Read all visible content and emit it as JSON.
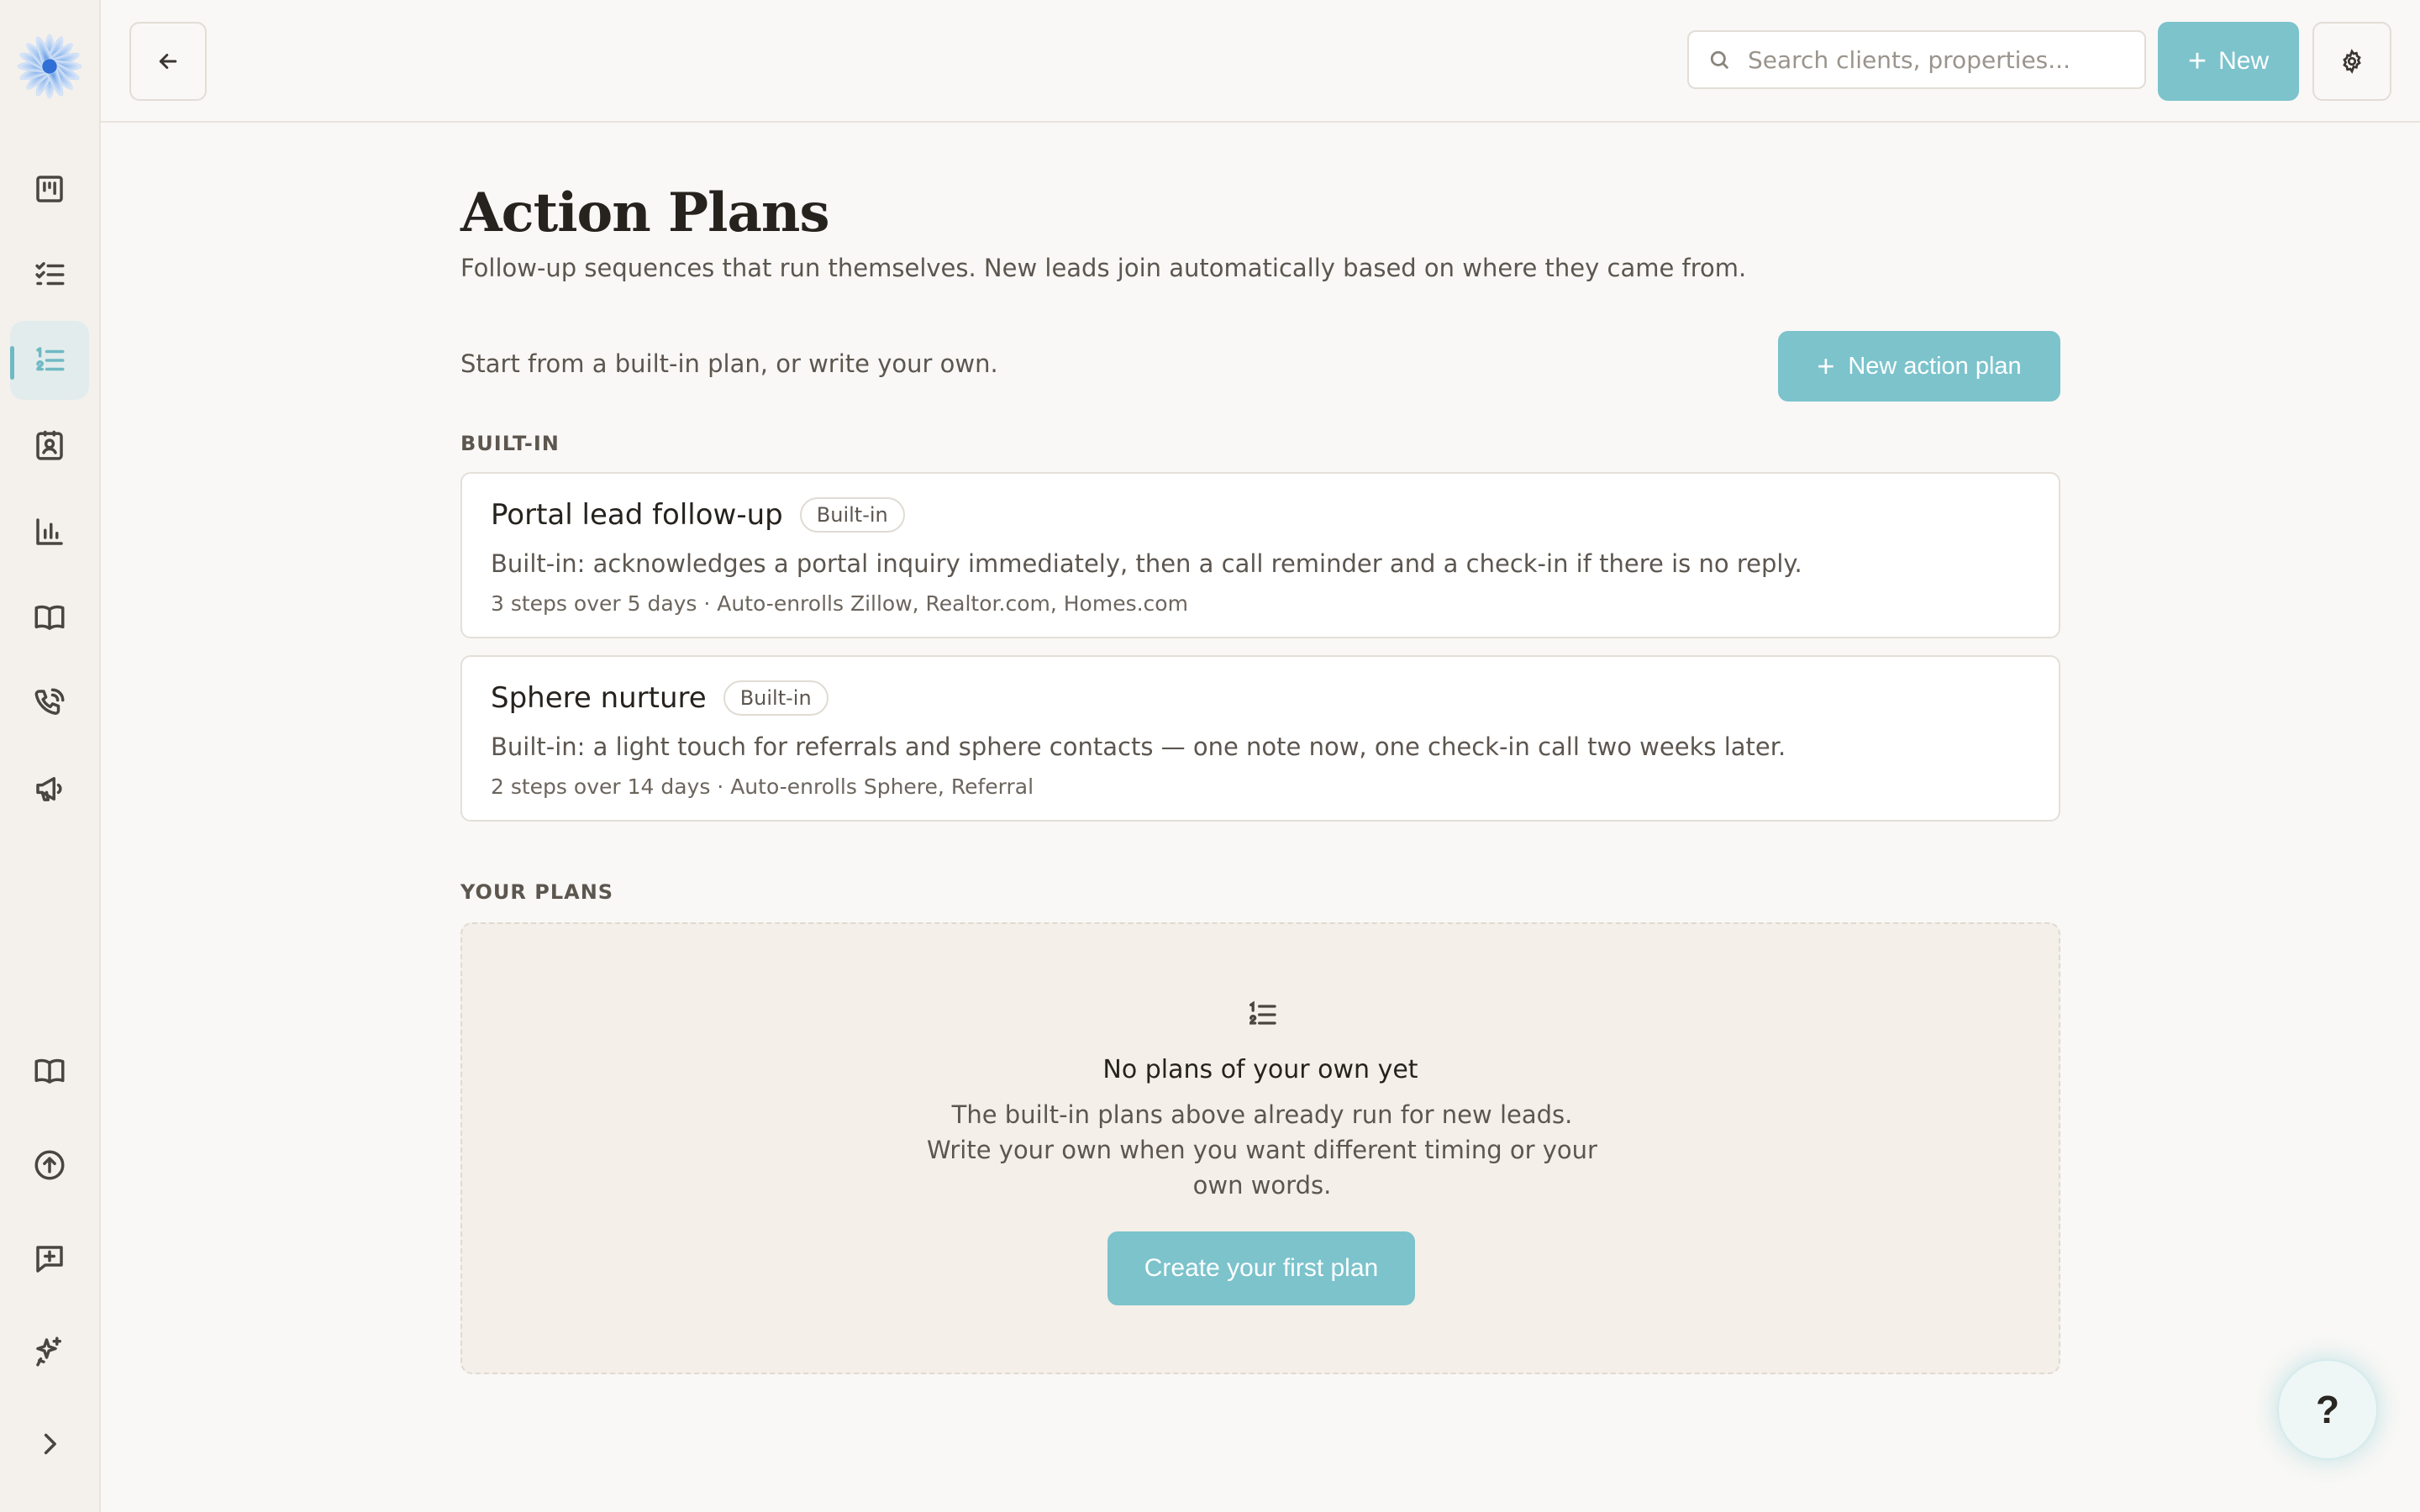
{
  "topbar": {
    "search_placeholder": "Search clients, properties...",
    "new_label": "New"
  },
  "sidebar": {
    "items": [
      {
        "icon": "kanban-board-icon"
      },
      {
        "icon": "checklist-icon"
      },
      {
        "icon": "numbered-list-icon",
        "active": true
      },
      {
        "icon": "contact-book-icon"
      },
      {
        "icon": "bar-chart-icon"
      },
      {
        "icon": "open-book-icon"
      },
      {
        "icon": "phone-icon"
      },
      {
        "icon": "megaphone-icon"
      }
    ],
    "bottom_items": [
      {
        "icon": "guide-book-icon"
      },
      {
        "icon": "upload-circle-icon"
      },
      {
        "icon": "feedback-message-icon"
      },
      {
        "icon": "sparkles-icon"
      },
      {
        "icon": "chevron-right-icon"
      }
    ]
  },
  "page": {
    "title": "Action Plans",
    "subtitle": "Follow-up sequences that run themselves. New leads join automatically based on where they came from.",
    "intro": "Start from a built-in plan, or write your own.",
    "new_plan_label": "New action plan"
  },
  "builtin": {
    "section_label": "BUILT-IN",
    "plans": [
      {
        "title": "Portal lead follow-up",
        "badge": "Built-in",
        "description": "Built-in: acknowledges a portal inquiry immediately, then a call reminder and a check-in if there is no reply.",
        "meta": "3 steps over 5 days · Auto-enrolls Zillow, Realtor.com, Homes.com"
      },
      {
        "title": "Sphere nurture",
        "badge": "Built-in",
        "description": "Built-in: a light touch for referrals and sphere contacts — one note now, one check-in call two weeks later.",
        "meta": "2 steps over 14 days · Auto-enrolls Sphere, Referral"
      }
    ]
  },
  "your_plans": {
    "section_label": "YOUR PLANS",
    "empty_title": "No plans of your own yet",
    "empty_description": "The built-in plans above already run for new leads. Write your own when you want different timing or your own words.",
    "create_label": "Create your first plan"
  },
  "help": {
    "label": "?"
  },
  "colors": {
    "accent": "#7cc3cc",
    "background": "#f9f8f6",
    "sidebar": "#f4f1ed",
    "text": "#26221e"
  }
}
